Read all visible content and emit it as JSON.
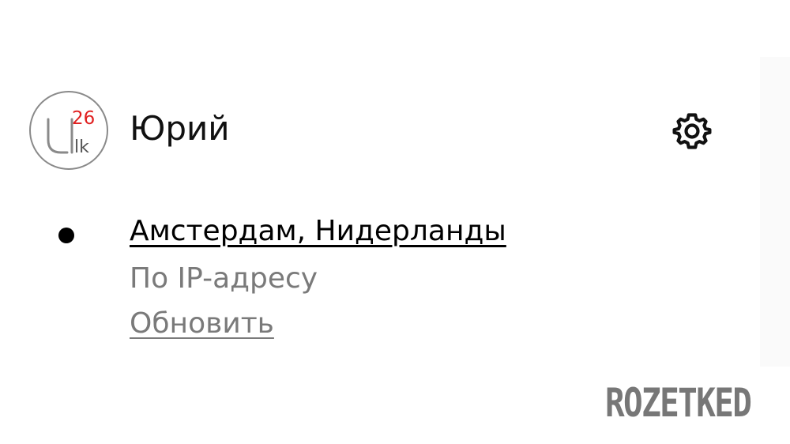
{
  "profile": {
    "name": "Юрий",
    "avatar": {
      "icon": "uk26-logo",
      "letter": "U",
      "suffix": "lk",
      "number": "26",
      "number_color": "#e02020",
      "stroke_color": "#8a8a8a"
    },
    "settings_icon": "gear-icon"
  },
  "location": {
    "city": "Амстердам, Нидерланды",
    "source": "По IP-адресу",
    "refresh_label": "Обновить"
  },
  "watermark": {
    "text": "ROZETKED"
  }
}
